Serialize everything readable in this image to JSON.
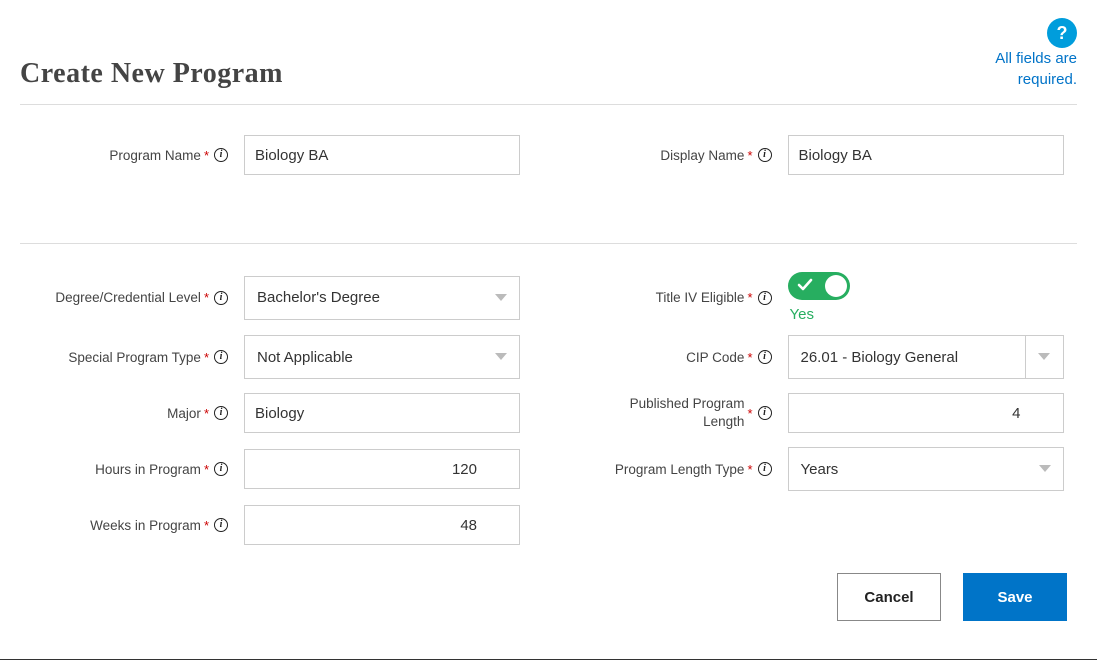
{
  "help_symbol": "?",
  "header": {
    "title": "Create New Program",
    "required_note_l1": "All fields are",
    "required_note_l2": "required."
  },
  "labels": {
    "program_name": "Program Name",
    "display_name": "Display Name",
    "degree_level": "Degree/Credential Level",
    "title_iv": "Title IV Eligible",
    "special_program_type": "Special Program Type",
    "cip_code": "CIP Code",
    "major": "Major",
    "published_length_l1": "Published Program",
    "published_length_l2": "Length",
    "hours_in_program": "Hours in Program",
    "program_length_type": "Program Length Type",
    "weeks_in_program": "Weeks in Program"
  },
  "values": {
    "program_name": "Biology BA",
    "display_name": "Biology BA",
    "degree_level": "Bachelor's Degree",
    "special_program_type": "Not Applicable",
    "major": "Biology",
    "hours_in_program": "120",
    "weeks_in_program": "48",
    "title_iv_eligible": true,
    "title_iv_label": "Yes",
    "cip_code": "26.01 - Biology General",
    "published_length": "4",
    "program_length_type": "Years"
  },
  "buttons": {
    "cancel": "Cancel",
    "save": "Save"
  },
  "info_glyph": "i",
  "required_glyph": "*"
}
